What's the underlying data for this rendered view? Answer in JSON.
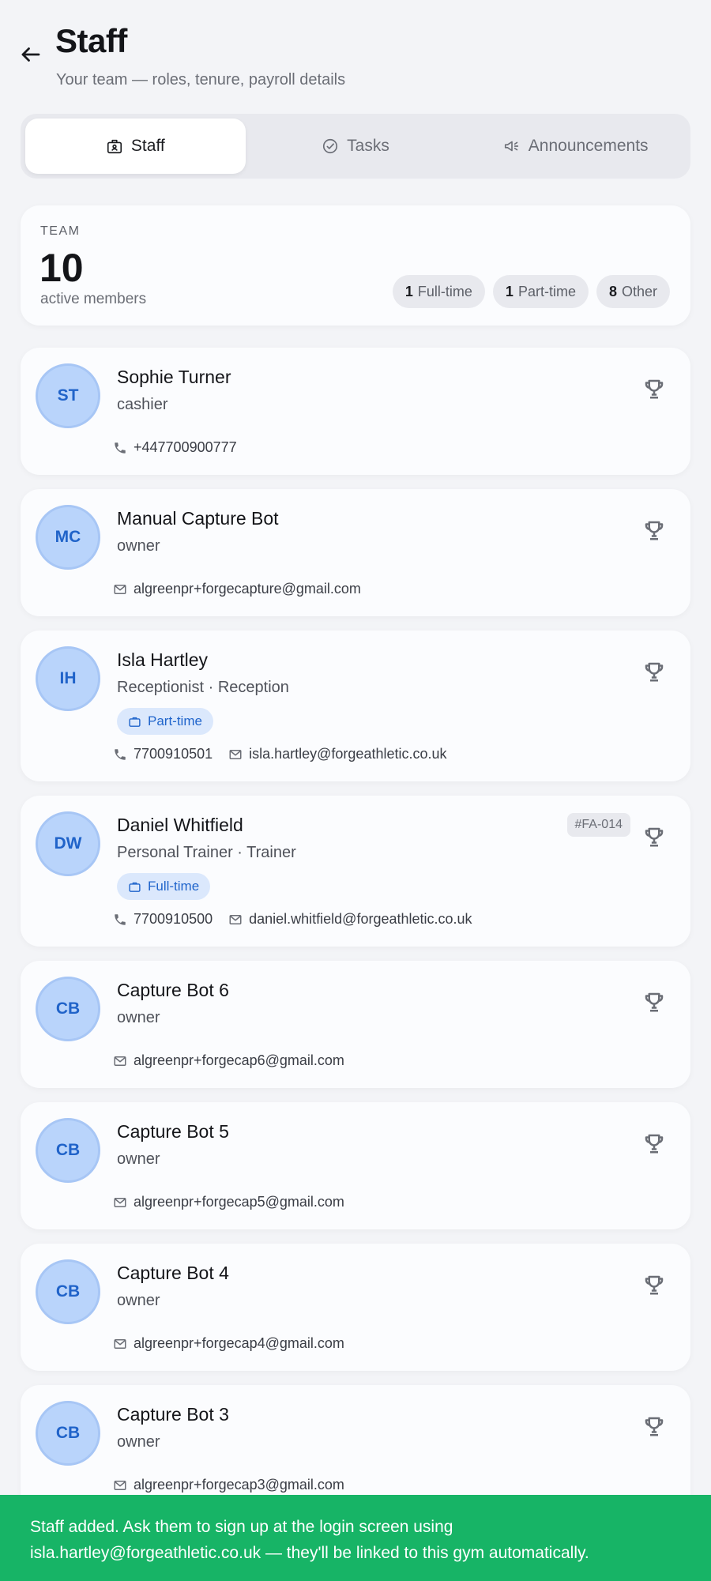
{
  "header": {
    "title": "Staff",
    "subtitle": "Your team — roles, tenure, payroll details"
  },
  "tabs": [
    {
      "label": "Staff",
      "icon": "id-badge-icon",
      "active": true
    },
    {
      "label": "Tasks",
      "icon": "check-circle-icon",
      "active": false
    },
    {
      "label": "Announcements",
      "icon": "megaphone-icon",
      "active": false
    }
  ],
  "team": {
    "label": "TEAM",
    "count": "10",
    "sub": "active members",
    "chips": [
      {
        "num": "1",
        "label": "Full-time"
      },
      {
        "num": "1",
        "label": "Part-time"
      },
      {
        "num": "8",
        "label": "Other"
      }
    ]
  },
  "staff": [
    {
      "initials": "ST",
      "name": "Sophie Turner",
      "role": "cashier",
      "phone": "+447700900777"
    },
    {
      "initials": "MC",
      "name": "Manual Capture Bot",
      "role": "owner",
      "email": "algreenpr+forgecapture@gmail.com"
    },
    {
      "initials": "IH",
      "name": "Isla Hartley",
      "role": "Receptionist · Reception",
      "badge": "Part-time",
      "phone": "7700910501",
      "email": "isla.hartley@forgeathletic.co.uk"
    },
    {
      "initials": "DW",
      "name": "Daniel Whitfield",
      "role": "Personal Trainer · Trainer",
      "badge": "Full-time",
      "code": "#FA-014",
      "phone": "7700910500",
      "email": "daniel.whitfield@forgeathletic.co.uk"
    },
    {
      "initials": "CB",
      "name": "Capture Bot 6",
      "role": "owner",
      "email": "algreenpr+forgecap6@gmail.com"
    },
    {
      "initials": "CB",
      "name": "Capture Bot 5",
      "role": "owner",
      "email": "algreenpr+forgecap5@gmail.com"
    },
    {
      "initials": "CB",
      "name": "Capture Bot 4",
      "role": "owner",
      "email": "algreenpr+forgecap4@gmail.com"
    },
    {
      "initials": "CB",
      "name": "Capture Bot 3",
      "role": "owner",
      "email": "algreenpr+forgecap3@gmail.com"
    }
  ],
  "snackbar": {
    "line1": "Staff added. Ask them to sign up at the login screen using",
    "line2": "isla.hartley@forgeathletic.co.uk — they'll be linked to this gym automatically."
  },
  "colors": {
    "accent": "#1f64cb",
    "avatar_bg": "#b9d4fb",
    "snackbar_bg": "#17b466",
    "page_bg": "#f3f4f7"
  }
}
